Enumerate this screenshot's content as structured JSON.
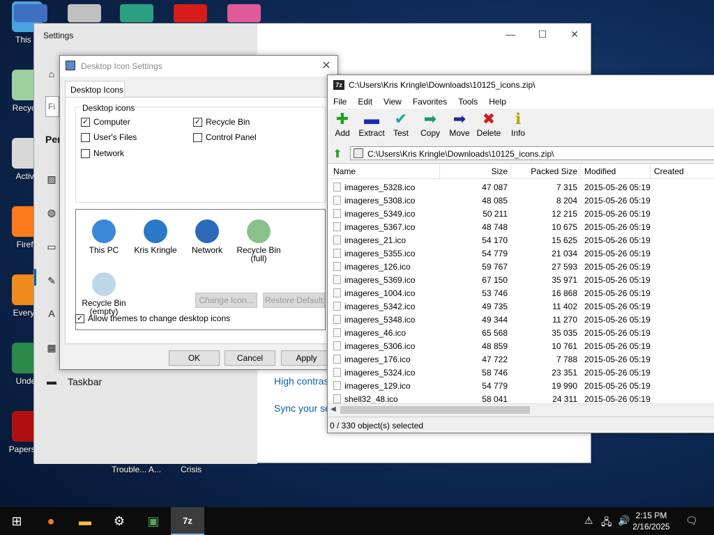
{
  "desktop": {
    "icons": [
      {
        "label": "This P",
        "icon": "computer-icon",
        "color": "#4aa3e0"
      },
      {
        "label": "Recycle",
        "icon": "recycle-bin-icon",
        "color": "#9ed0a0"
      },
      {
        "label": "Activa",
        "icon": "folder-icon",
        "color": "#d8d8d8"
      },
      {
        "label": "Firefo",
        "icon": "firefox-icon",
        "color": "#ff7a1a"
      },
      {
        "label": "Everyth",
        "icon": "search-magnifier-icon",
        "color": "#f08a1a"
      },
      {
        "label": "Under",
        "icon": "game-character-icon",
        "color": "#2a8a4a"
      },
      {
        "label": "Papers, P",
        "icon": "stamp-icon",
        "color": "#b01010"
      }
    ],
    "top_icon_colors": [
      "#3f6fc0",
      "#c0c0c0",
      "#2aa080",
      "#d81c1c",
      "#e05a9a"
    ],
    "bottom_labels": [
      "Trouble... A...",
      "Crisis"
    ]
  },
  "settings": {
    "title": "Settings",
    "search_placeholder": "Fi",
    "section_label": "Per",
    "taskbar_item": "Taskbar",
    "link_high_contrast": "High contras",
    "link_sync": "Sync your se"
  },
  "desktop_icon_settings": {
    "title": "Desktop Icon Settings",
    "tab": "Desktop Icons",
    "group_label": "Desktop icons",
    "checkboxes": {
      "computer": {
        "label": "Computer",
        "checked": true
      },
      "recycle_bin": {
        "label": "Recycle Bin",
        "checked": true
      },
      "users_files": {
        "label": "User's Files",
        "checked": false
      },
      "control_panel": {
        "label": "Control Panel",
        "checked": false
      },
      "network": {
        "label": "Network",
        "checked": false
      }
    },
    "icons": [
      {
        "label": "This PC",
        "color": "#3a88d8"
      },
      {
        "label": "Kris Kringle",
        "color": "#2a78c8"
      },
      {
        "label": "Network",
        "color": "#2a6ab8"
      },
      {
        "label": "Recycle Bin\n(full)",
        "color": "#8ac08a"
      },
      {
        "label": "Recycle Bin\n(empty)",
        "color": "#bcd8e8"
      }
    ],
    "change_icon": "Change Icon...",
    "restore_default": "Restore Default",
    "allow_themes": "Allow themes to change desktop icons",
    "allow_themes_checked": true,
    "ok": "OK",
    "cancel": "Cancel",
    "apply": "Apply"
  },
  "zip": {
    "logo": "7z",
    "title": "C:\\Users\\Kris Kringle\\Downloads\\10125_icons.zip\\",
    "menu": [
      "File",
      "Edit",
      "View",
      "Favorites",
      "Tools",
      "Help"
    ],
    "toolbar": [
      {
        "label": "Add",
        "glyph": "✚",
        "color": "#1ea01e",
        "icon": "add-icon"
      },
      {
        "label": "Extract",
        "glyph": "▬",
        "color": "#1a2ab8",
        "icon": "extract-icon"
      },
      {
        "label": "Test",
        "glyph": "✔",
        "color": "#1aa0a0",
        "icon": "test-icon"
      },
      {
        "label": "Copy",
        "glyph": "➡",
        "color": "#1a9a6a",
        "icon": "copy-icon"
      },
      {
        "label": "Move",
        "glyph": "➡",
        "color": "#1a2a9a",
        "icon": "move-icon"
      },
      {
        "label": "Delete",
        "glyph": "✖",
        "color": "#d01a1a",
        "icon": "delete-icon"
      },
      {
        "label": "Info",
        "glyph": "ℹ",
        "color": "#b8a000",
        "icon": "info-icon"
      }
    ],
    "address": "C:\\Users\\Kris Kringle\\Downloads\\10125_icons.zip\\",
    "columns": [
      "Name",
      "Size",
      "Packed Size",
      "Modified",
      "Created"
    ],
    "rows": [
      [
        "imageres_5328.ico",
        "47 087",
        "7 315",
        "2015-05-26 05:19"
      ],
      [
        "imageres_5308.ico",
        "48 085",
        "8 204",
        "2015-05-26 05:19"
      ],
      [
        "imageres_5349.ico",
        "50 211",
        "12 215",
        "2015-05-26 05:19"
      ],
      [
        "imageres_5367.ico",
        "48 748",
        "10 675",
        "2015-05-26 05:19"
      ],
      [
        "imageres_21.ico",
        "54 170",
        "15 625",
        "2015-05-26 05:19"
      ],
      [
        "imageres_5355.ico",
        "54 779",
        "21 034",
        "2015-05-26 05:19"
      ],
      [
        "imageres_126.ico",
        "59 767",
        "27 593",
        "2015-05-26 05:19"
      ],
      [
        "imageres_5369.ico",
        "67 150",
        "35 971",
        "2015-05-26 05:19"
      ],
      [
        "imageres_1004.ico",
        "53 746",
        "16 868",
        "2015-05-26 05:19"
      ],
      [
        "imageres_5342.ico",
        "49 735",
        "11 402",
        "2015-05-26 05:19"
      ],
      [
        "imageres_5348.ico",
        "49 344",
        "11 270",
        "2015-05-26 05:19"
      ],
      [
        "imageres_46.ico",
        "65 568",
        "35 035",
        "2015-05-26 05:19"
      ],
      [
        "imageres_5306.ico",
        "48 859",
        "10 761",
        "2015-05-26 05:19"
      ],
      [
        "imageres_176.ico",
        "47 722",
        "7 788",
        "2015-05-26 05:19"
      ],
      [
        "imageres_5324.ico",
        "58 746",
        "23 351",
        "2015-05-26 05:19"
      ],
      [
        "imageres_129.ico",
        "54 779",
        "19 990",
        "2015-05-26 05:19"
      ],
      [
        "shell32_48.ico",
        "58 041",
        "24 311",
        "2015-05-26 05:19"
      ]
    ],
    "status": "0 / 330 object(s) selected"
  },
  "taskbar": {
    "time": "2:15 PM",
    "date": "2/16/2025",
    "items": [
      {
        "icon": "windows-start-icon",
        "glyph": "⊞",
        "color": "#ffffff"
      },
      {
        "icon": "firefox-icon",
        "glyph": "●",
        "color": "#ff7a1a"
      },
      {
        "icon": "file-explorer-icon",
        "glyph": "▬",
        "color": "#f0c040"
      },
      {
        "icon": "settings-gear-icon",
        "glyph": "⚙",
        "color": "#ffffff"
      },
      {
        "icon": "control-panel-icon",
        "glyph": "▣",
        "color": "#5aa05a"
      },
      {
        "icon": "7zip-icon",
        "glyph": "7z",
        "color": "#ffffff"
      }
    ]
  }
}
